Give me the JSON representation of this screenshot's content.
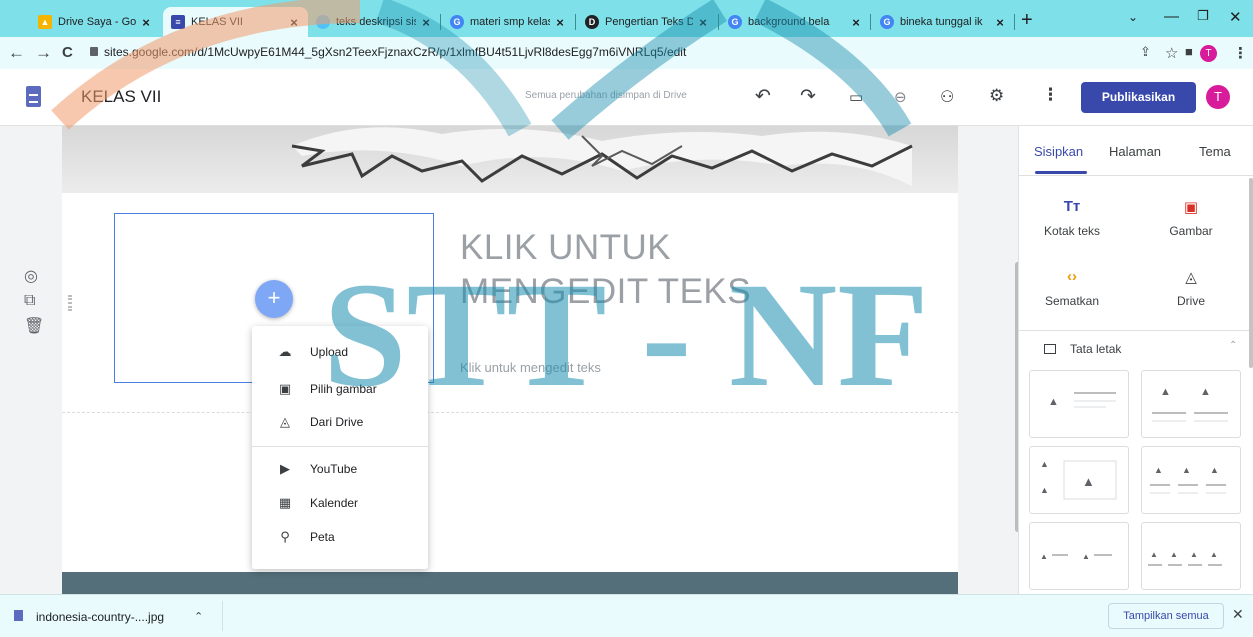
{
  "browser": {
    "tabs": [
      {
        "title": "Drive Saya - Goo",
        "favicon": "google-drive-icon",
        "color": "#f4b400"
      },
      {
        "title": "KELAS VII",
        "favicon": "google-sites-icon",
        "color": "#3949ab",
        "active": true
      },
      {
        "title": "teks deskripsi sis",
        "favicon": "loading-icon",
        "color": "#4fc3f7"
      },
      {
        "title": "materi smp kelas",
        "favicon": "google-icon",
        "color": "#4285f4"
      },
      {
        "title": "Pengertian Teks D",
        "favicon": "d-icon",
        "color": "#202124"
      },
      {
        "title": "background bela",
        "favicon": "google-icon",
        "color": "#4285f4"
      },
      {
        "title": "bineka tunggal ik",
        "favicon": "google-icon",
        "color": "#4285f4"
      }
    ],
    "new_tab": "+",
    "url": "sites.google.com/d/1McUwpyE61M44_5gXsn2TeexFjznaxCzR/p/1xlmfBU4t51LjvRl8desEgg7m6iVNRLq5/edit",
    "profile_initial": "T"
  },
  "app": {
    "site_title": "KELAS VII",
    "save_status": "Semua perubahan disimpan di Drive",
    "publish_label": "Publikasikan",
    "avatar_initial": "T"
  },
  "page": {
    "heading": "KLIK UNTUK MENGEDIT TEKS",
    "subtext": "Klik untuk mengedit teks"
  },
  "add_menu": {
    "items": [
      {
        "label": "Upload",
        "icon": "upload-cloud-icon"
      },
      {
        "label": "Pilih gambar",
        "icon": "image-icon"
      },
      {
        "label": "Dari Drive",
        "icon": "drive-icon"
      },
      {
        "label": "YouTube",
        "icon": "youtube-icon"
      },
      {
        "label": "Kalender",
        "icon": "calendar-icon"
      },
      {
        "label": "Peta",
        "icon": "map-pin-icon"
      }
    ]
  },
  "right_panel": {
    "tabs": [
      "Sisipkan",
      "Halaman",
      "Tema"
    ],
    "inserts": [
      {
        "label": "Kotak teks",
        "icon": "text-box-icon",
        "glyph": "Tт"
      },
      {
        "label": "Gambar",
        "icon": "image-icon",
        "glyph": "▣"
      },
      {
        "label": "Sematkan",
        "icon": "embed-icon",
        "glyph": "‹›"
      },
      {
        "label": "Drive",
        "icon": "drive-icon",
        "glyph": "◬"
      }
    ],
    "layout_label": "Tata letak"
  },
  "downloads": {
    "file": "indonesia-country-....jpg",
    "show_all": "Tampilkan semua"
  },
  "watermark": "STT - NF",
  "colors": {
    "accent": "#3949ab",
    "tab_strip": "#7ee0e8",
    "watermark": "#1b8fb0",
    "watermark_arc": "#f29a6b"
  }
}
